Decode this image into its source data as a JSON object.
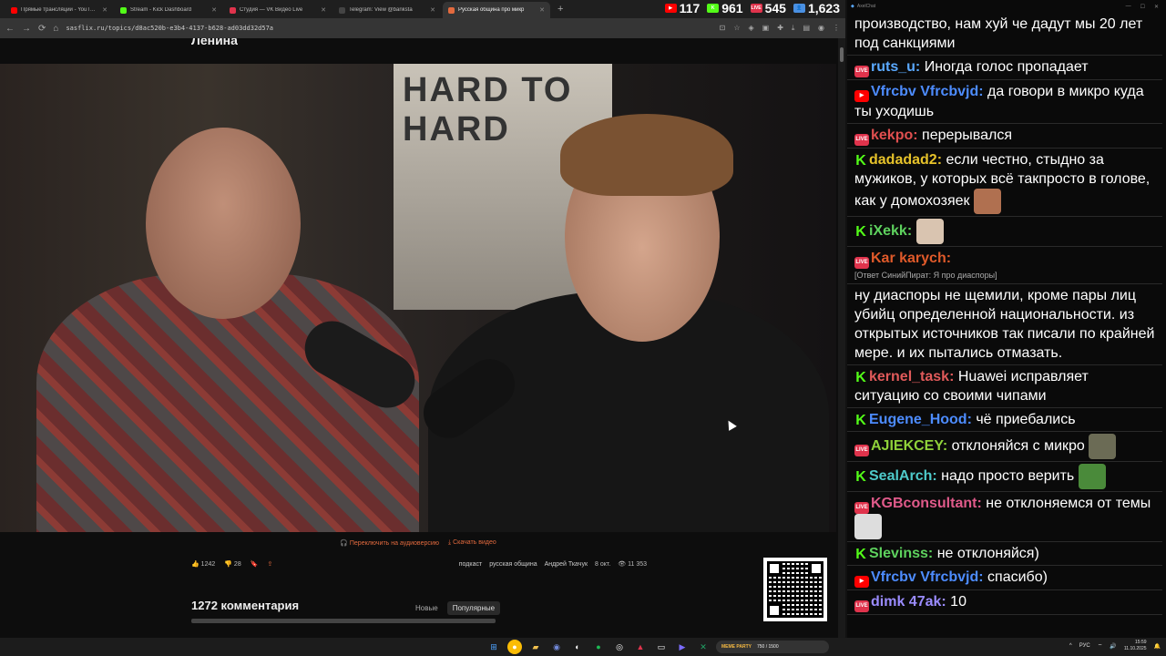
{
  "tabs": [
    {
      "label": "Прямые трансляции - YouTube",
      "color": "#ff0000"
    },
    {
      "label": "Stream - Kick Dashboard",
      "color": "#53fc18"
    },
    {
      "label": "Студия — VK Видео Live",
      "color": "#e0334c"
    },
    {
      "label": "Telegram: View @banksta",
      "color": "#444444"
    },
    {
      "label": "Русская община про микр",
      "color": "#e36a3e",
      "active": true
    }
  ],
  "stats": [
    {
      "badge": "▶",
      "color": "#ff0000",
      "value": "117"
    },
    {
      "badge": "K",
      "color": "#53fc18",
      "value": "961"
    },
    {
      "badge": "LIVE",
      "color": "#e0334c",
      "value": "545"
    },
    {
      "badge": "👤",
      "color": "#4a90e2",
      "value": "1,623"
    }
  ],
  "url": "sasflix.ru/topics/d8ac520b-e3b4-4137-b628-ad03dd32d57a",
  "page": {
    "title": "Ленина",
    "audio_link": "Переключить на аудиоверсию",
    "download_link": "Скачать видео",
    "likes": "1242",
    "dislikes": "28",
    "tags": [
      "подкаст",
      "русская община",
      "Андрей Ткачук"
    ],
    "date": "8 окт.",
    "views": "11 353",
    "comments_count": "1272 комментария",
    "sort_new": "Новые",
    "sort_popular": "Популярные",
    "poster_text": "HARD TO HARD"
  },
  "chat": {
    "window_title": "AxelChat",
    "messages": [
      {
        "platform": "none",
        "nick": "",
        "nick_color": "#ffffff",
        "text": "производство, нам хуй че дадут мы 20 лет под санкциями"
      },
      {
        "platform": "vk",
        "nick": "ruts_u:",
        "nick_color": "#5aa9ff",
        "text": "Иногда голос пропадает"
      },
      {
        "platform": "yt",
        "nick": "Vfrcbv Vfrcbvjd:",
        "nick_color": "#4d8cff",
        "text": "да говори в микро куда ты уходишь"
      },
      {
        "platform": "vk",
        "nick": "kekpo:",
        "nick_color": "#e04f4f",
        "text": "перерывался"
      },
      {
        "platform": "kick",
        "nick": "dadadad2:",
        "nick_color": "#e6c22a",
        "text": "если честно, стыдно за мужиков, у которых всё такпросто в голове, как у домохозяек",
        "emote": "#b07050"
      },
      {
        "platform": "kick",
        "nick": "iXekk:",
        "nick_color": "#5ed25e",
        "text": "",
        "emote": "#d9c4b0"
      },
      {
        "platform": "vk",
        "nick": "Kar karych:",
        "nick_color": "#e05a2a",
        "text": "",
        "reply": "[Ответ СинийПират: Я про диаспоры]"
      },
      {
        "platform": "none",
        "nick": "",
        "nick_color": "#ffffff",
        "text": "ну диаспоры не щемили, кроме пары лиц убийц определенной национальности. из открытых источников так писали по крайней мере. и их пытались отмазать."
      },
      {
        "platform": "kick",
        "nick": "kernel_task:",
        "nick_color": "#e05a5a",
        "text": "Huawei исправляет ситуацию со своими чипами"
      },
      {
        "platform": "kick",
        "nick": "Eugene_Hood:",
        "nick_color": "#4d8cff",
        "text": "чё приебались"
      },
      {
        "platform": "vk",
        "nick": "AJIEKCEY:",
        "nick_color": "#8fd13a",
        "text": "отклоняйся с микро",
        "emote": "#6b6b55"
      },
      {
        "platform": "kick",
        "nick": "SealArch:",
        "nick_color": "#4ec9c9",
        "text": "надо просто верить",
        "emote": "#4a8a3a"
      },
      {
        "platform": "vk",
        "nick": "KGBconsultant:",
        "nick_color": "#e05a8a",
        "text": "не отклоняемся от темы",
        "emote": "#dddddd"
      },
      {
        "platform": "kick",
        "nick": "Slevinss:",
        "nick_color": "#5ed25e",
        "text": "не отклоняйся)"
      },
      {
        "platform": "yt",
        "nick": "Vfrcbv Vfrcbvjd:",
        "nick_color": "#4d8cff",
        "text": "спасибо)"
      },
      {
        "platform": "vk",
        "nick": "dimk 47ak:",
        "nick_color": "#9b8cff",
        "text": "10"
      }
    ]
  },
  "taskbar": {
    "meme_label": "MEME PARTY",
    "meme_progress": "750 / 1500",
    "lang": "РУС",
    "time": "15:59",
    "date": "11.10.2025"
  }
}
